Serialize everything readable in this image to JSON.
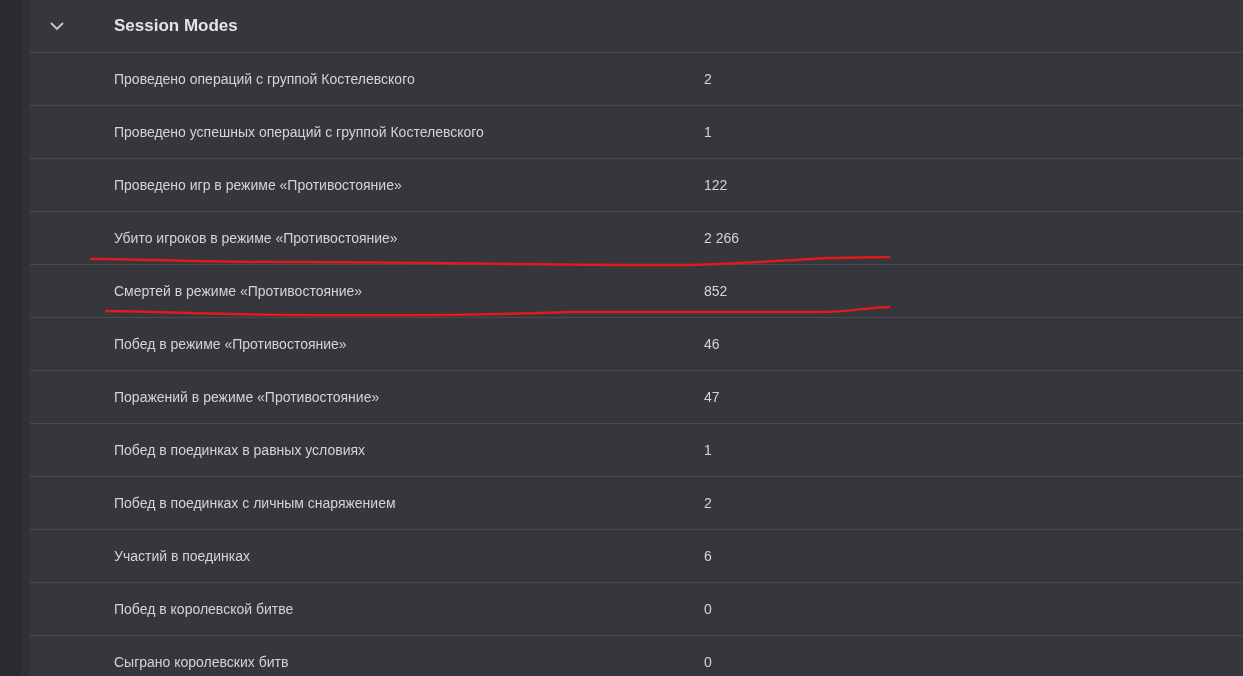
{
  "section": {
    "title": "Session Modes",
    "expanded": true
  },
  "rows": [
    {
      "label": "Проведено операций с группой Костелевского",
      "value": "2",
      "underlined": false
    },
    {
      "label": "Проведено успешных операций с группой Костелевского",
      "value": "1",
      "underlined": false
    },
    {
      "label": "Проведено игр в режиме «Противостояние»",
      "value": "122",
      "underlined": false
    },
    {
      "label": "Убито игроков в режиме «Противостояние»",
      "value": "2 266",
      "underlined": true
    },
    {
      "label": "Смертей в режиме «Противостояние»",
      "value": "852",
      "underlined": true
    },
    {
      "label": "Побед в режиме «Противостояние»",
      "value": "46",
      "underlined": false
    },
    {
      "label": "Поражений в режиме «Противостояние»",
      "value": "47",
      "underlined": false
    },
    {
      "label": "Побед в поединках в равных условиях",
      "value": "1",
      "underlined": false
    },
    {
      "label": "Побед в поединках с личным снаряжением",
      "value": "2",
      "underlined": false
    },
    {
      "label": "Участий в поединках",
      "value": "6",
      "underlined": false
    },
    {
      "label": "Побед в королевской битве",
      "value": "0",
      "underlined": false
    },
    {
      "label": "Сыграно королевских битв",
      "value": "0",
      "underlined": false
    }
  ]
}
